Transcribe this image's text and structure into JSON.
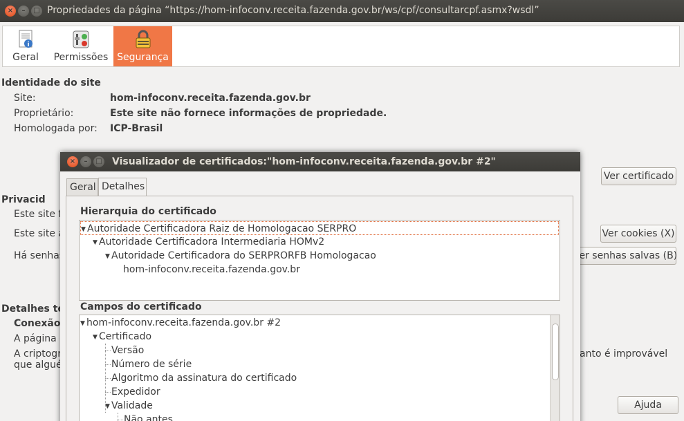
{
  "window": {
    "title": "Propriedades da página “https://hom-infoconv.receita.fazenda.gov.br/ws/cpf/consultarcpf.asmx?wsdl”"
  },
  "toolbar": {
    "items": [
      {
        "label": "Geral",
        "icon": "document-info-icon"
      },
      {
        "label": "Permissões",
        "icon": "permissions-icon"
      },
      {
        "label": "Segurança",
        "icon": "lock-icon"
      }
    ]
  },
  "identity": {
    "heading": "Identidade do site",
    "site_label": "Site:",
    "site_value": "hom-infoconv.receita.fazenda.gov.br",
    "owner_label": "Proprietário:",
    "owner_value": "Este site não fornece informações de propriedade.",
    "verified_label": "Homologada por:",
    "verified_value": "ICP-Brasil",
    "view_cert_button": "Ver certificado"
  },
  "privacy": {
    "heading": "Privacid",
    "row1": "Este site f",
    "row2": "Este site a",
    "row3": "Há senhas",
    "view_cookies_button": "Ver cookies (X)",
    "view_passwords_button": "Ver senhas salvas (B)"
  },
  "technical": {
    "heading": "Detalhes té",
    "connection": "Conexão",
    "line1": "A página e",
    "line2": "A criptogr",
    "line2_tail": "anto é improvável",
    "line3": "que alguér"
  },
  "help_button": "Ajuda",
  "dialog": {
    "title": "Visualizador de certificados:\"hom-infoconv.receita.fazenda.gov.br #2\"",
    "tabs": [
      "Geral",
      "Detalhes"
    ],
    "hierarchy_heading": "Hierarquia do certificado",
    "hierarchy": [
      "Autoridade Certificadora Raiz de Homologacao SERPRO",
      "Autoridade Certificadora Intermediaria HOMv2",
      "Autoridade Certificadora do SERPRORFB Homologacao",
      "hom-infoconv.receita.fazenda.gov.br"
    ],
    "fields_heading": "Campos do certificado",
    "fields": [
      "hom-infoconv.receita.fazenda.gov.br #2",
      "Certificado",
      "Versão",
      "Número de série",
      "Algoritmo da assinatura do certificado",
      "Expedidor",
      "Validade",
      "Não antes"
    ]
  }
}
